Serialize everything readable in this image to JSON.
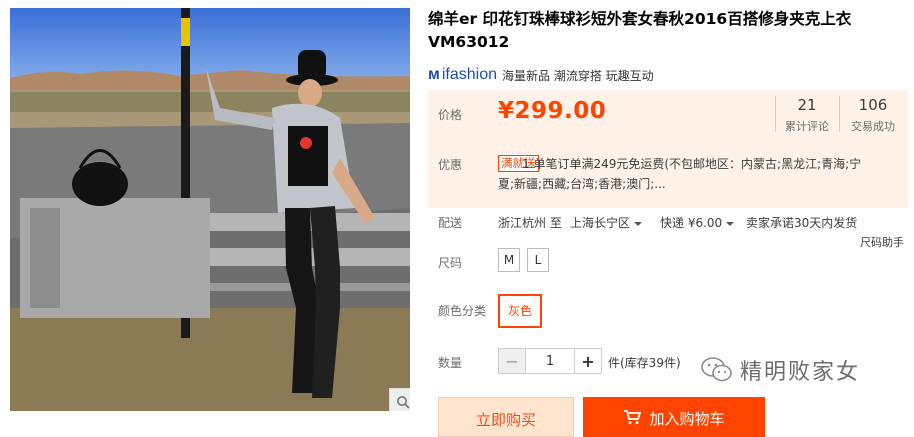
{
  "product": {
    "title": "绵羊er 印花钉珠棒球衫短外套女春秋2016百搭修身夹克上衣VM63012"
  },
  "brand": {
    "name": "ifashion",
    "slogan": "海量新品 潮流穿搭 玩趣互动"
  },
  "price": {
    "label": "价格",
    "value": "¥299.00"
  },
  "stats": {
    "reviews_count": "21",
    "reviews_label": "累计评论",
    "sales_count": "106",
    "sales_label": "交易成功"
  },
  "promo": {
    "label": "优惠",
    "badge": "满就送",
    "text_line1": "1.单笔订单满249元免运费(不包邮地区：内蒙古;黑龙江;青海;宁",
    "text_line2": "夏;新疆;西藏;台湾;香港;澳门;..."
  },
  "shipping": {
    "label": "配送",
    "from": "浙江杭州 至",
    "to": "上海长宁区",
    "method": "快递 ¥6.00",
    "promise": "卖家承诺30天内发货",
    "size_help": "尺码助手"
  },
  "size": {
    "label": "尺码",
    "options": [
      "M",
      "L"
    ]
  },
  "color": {
    "label": "颜色分类",
    "options": [
      "灰色"
    ]
  },
  "quantity": {
    "label": "数量",
    "minus": "−",
    "value": "1",
    "plus": "+",
    "stock": "件(库存39件)"
  },
  "actions": {
    "buy_now": "立即购买",
    "add_to_cart": "加入购物车"
  },
  "watermark": {
    "text": "精明败家女"
  },
  "colors": {
    "accent": "#ff4400",
    "price_bg": "#fff2e8",
    "brand_blue": "#1f4fa8"
  }
}
